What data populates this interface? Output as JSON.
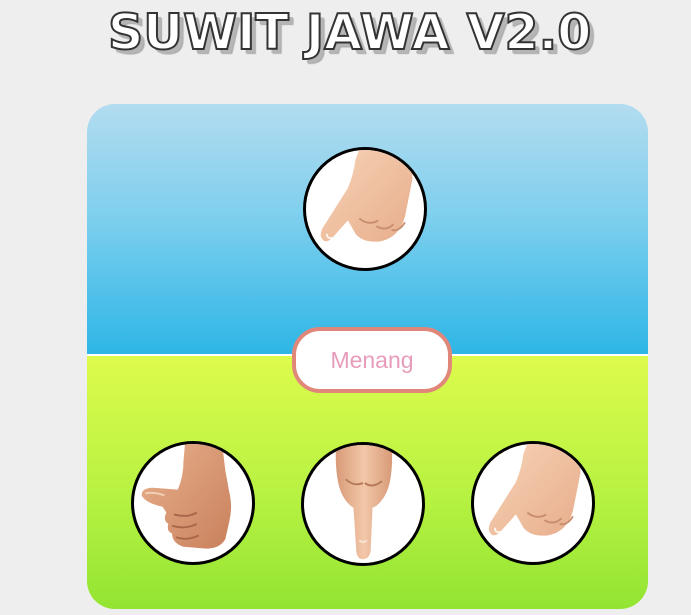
{
  "title": "SUWIT JAWA V2.0",
  "result_text": "Menang",
  "computer_choice": {
    "icon": "pointing-hand-icon",
    "label": "semut"
  },
  "player_choices": [
    {
      "icon": "thumb-icon",
      "label": "gajah"
    },
    {
      "icon": "pointing-down-hand-icon",
      "label": "orang"
    },
    {
      "icon": "pointing-hand-icon",
      "label": "semut"
    }
  ],
  "colors": {
    "sky_top": "#b3dcef",
    "sky_bottom": "#2eb6e6",
    "grass_top": "#ddfb4c",
    "grass_bottom": "#93e432",
    "result_border": "#e0877a",
    "result_text": "#e79cbb",
    "background": "#eeeeee"
  }
}
